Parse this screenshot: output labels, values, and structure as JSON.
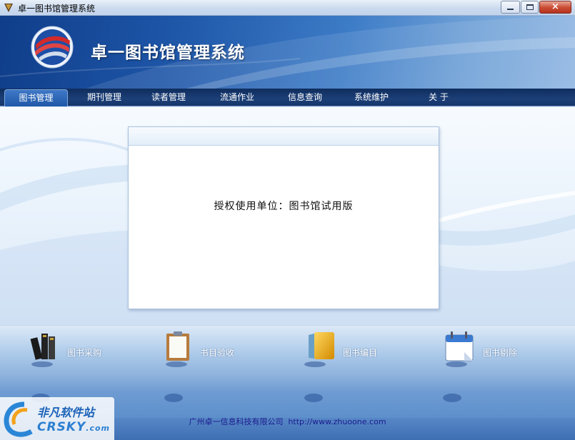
{
  "window": {
    "title": "卓一图书馆管理系统",
    "minimize_glyph": "",
    "maximize_glyph": "",
    "close_glyph": "×"
  },
  "header": {
    "app_title": "卓一图书馆管理系统"
  },
  "nav": {
    "items": [
      {
        "label": "图书管理",
        "active": true
      },
      {
        "label": "期刊管理",
        "active": false
      },
      {
        "label": "读者管理",
        "active": false
      },
      {
        "label": "流通作业",
        "active": false
      },
      {
        "label": "信息查询",
        "active": false
      },
      {
        "label": "系统维护",
        "active": false
      },
      {
        "label": "关  于",
        "active": false
      }
    ]
  },
  "main": {
    "license_text": "授权使用单位：图书馆试用版"
  },
  "shortcuts": [
    {
      "label": "图书采购",
      "icon": "books-icon"
    },
    {
      "label": "书目验收",
      "icon": "clipboard-icon"
    },
    {
      "label": "图书编目",
      "icon": "folder-icon"
    },
    {
      "label": "图书剔除",
      "icon": "calendar-icon"
    }
  ],
  "footer": {
    "company": "广州卓一信息科技有限公司",
    "url": "http://www.zhuoone.com"
  },
  "watermark": {
    "cn": "非凡软件站",
    "en": "CRSKY",
    "domain": ".com"
  },
  "colors": {
    "nav_bg": "#16366a",
    "nav_active": "#2f68b8",
    "banner_dark": "#0f3d89",
    "footer_text": "#1a1a8c"
  }
}
